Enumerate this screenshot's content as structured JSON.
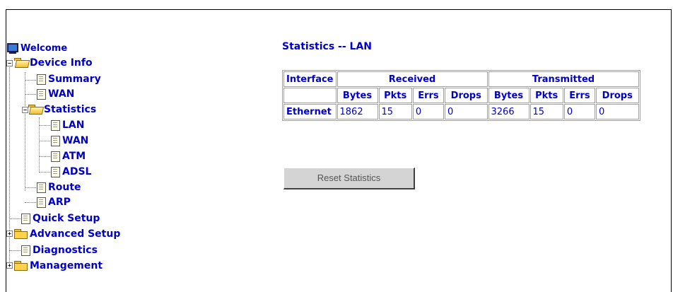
{
  "tree": {
    "welcome": "Welcome",
    "device_info": "Device Info",
    "summary": "Summary",
    "wan": "WAN",
    "statistics": "Statistics",
    "stat_lan": "LAN",
    "stat_wan": "WAN",
    "stat_atm": "ATM",
    "stat_adsl": "ADSL",
    "route": "Route",
    "arp": "ARP",
    "quick_setup": "Quick Setup",
    "advanced_setup": "Advanced Setup",
    "diagnostics": "Diagnostics",
    "management": "Management"
  },
  "page": {
    "title": "Statistics -- LAN"
  },
  "table": {
    "h_interface": "Interface",
    "h_received": "Received",
    "h_transmitted": "Transmitted",
    "sub": [
      "Bytes",
      "Pkts",
      "Errs",
      "Drops",
      "Bytes",
      "Pkts",
      "Errs",
      "Drops"
    ],
    "row": {
      "interface": "Ethernet",
      "values": [
        "1862",
        "15",
        "0",
        "0",
        "3266",
        "15",
        "0",
        "0"
      ]
    }
  },
  "reset_button": "Reset Statistics",
  "colors": {
    "link": "#0000cc",
    "border": "#a0a0a0",
    "button": "#d4d4d4"
  },
  "icons": [
    "monitor-icon",
    "folder-icon",
    "folder-open-icon",
    "document-icon",
    "expand-icon",
    "collapse-icon"
  ]
}
